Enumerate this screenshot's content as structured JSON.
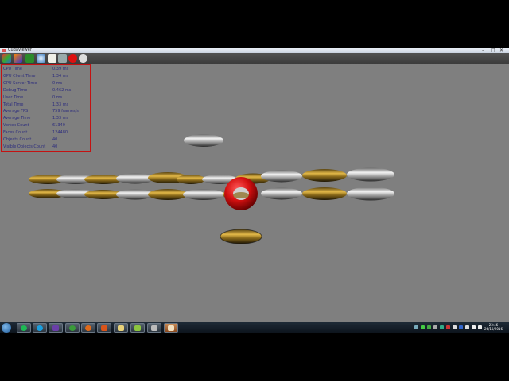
{
  "window": {
    "title": "CudaViewer",
    "minimize": "–",
    "maximize": "□",
    "close": "✕"
  },
  "toolbar": {
    "icons": [
      "scene-icon",
      "palette-icon",
      "chart-icon",
      "shield-icon",
      "document-icon",
      "monitor-icon",
      "stop-icon",
      "info-icon"
    ]
  },
  "stats": [
    {
      "label": "CPU Time",
      "value": "0.39 ms"
    },
    {
      "label": "GPU Client Time",
      "value": "1.34 ms"
    },
    {
      "label": "GPU Server Time",
      "value": "0 ms"
    },
    {
      "label": "Debug Time",
      "value": "0.462 ms"
    },
    {
      "label": "User Time",
      "value": "0 ms"
    },
    {
      "label": "Total Time",
      "value": "1.33 ms"
    },
    {
      "label": "Average FPS",
      "value": "759 frames/s"
    },
    {
      "label": "Average Time",
      "value": "1.33 ms"
    },
    {
      "label": "Vertex Count",
      "value": "61340"
    },
    {
      "label": "Faces Count",
      "value": "124480"
    },
    {
      "label": "Objects Count",
      "value": "40"
    },
    {
      "label": "Visible Objects Count",
      "value": "40"
    }
  ],
  "colors": {
    "viewport_bg": "#7f7f7f",
    "panel_border": "#c41212",
    "stat_text": "#2e2e7e",
    "torus_red": "#d41010",
    "gold": "#b08a2a",
    "silver": "#c8c8c8"
  },
  "taskbar": {
    "apps": [
      "explorer-icon",
      "spotify-icon",
      "skype-icon",
      "visual-studio-icon",
      "xbox-icon",
      "firefox-icon",
      "matlab-icon",
      "files-icon",
      "notepad-icon",
      "tools-icon",
      "cuda-viewer-icon"
    ],
    "clock_time": "23:46",
    "clock_date": "26/10/2016"
  }
}
